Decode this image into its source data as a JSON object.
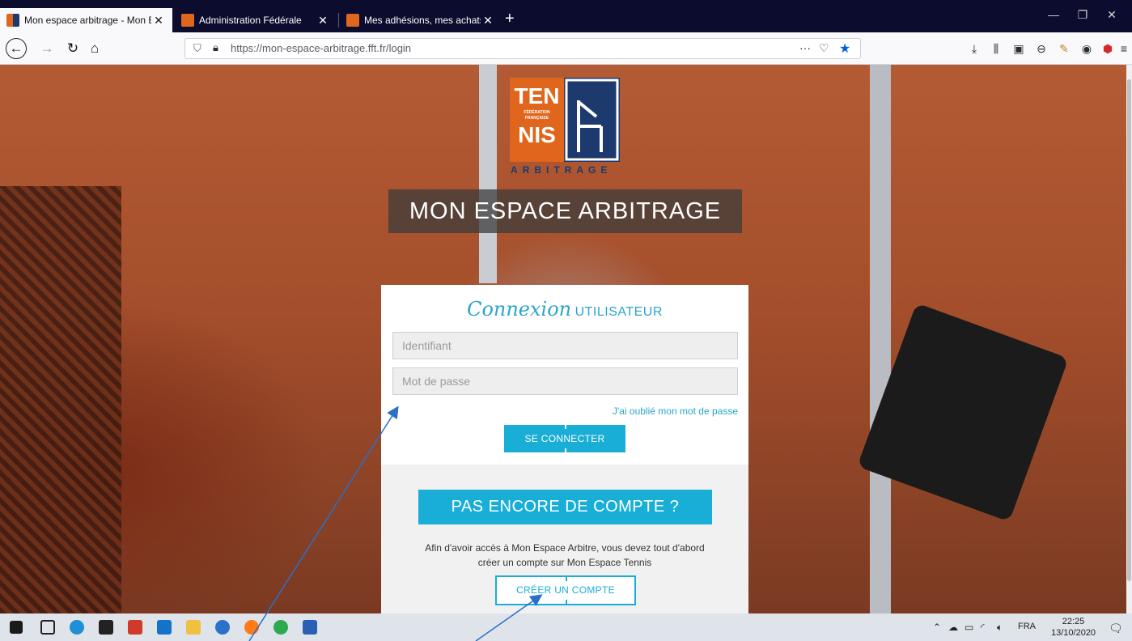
{
  "browser": {
    "tabs": [
      {
        "title": "Mon espace arbitrage - Mon E"
      },
      {
        "title": "Administration Fédérale"
      },
      {
        "title": "Mes adhésions, mes achats | Te"
      }
    ],
    "url": "https://mon-espace-arbitrage.fft.fr/login"
  },
  "logo": {
    "line1": "TEN",
    "line2": "NIS",
    "small1": "FÉDÉRATION",
    "small2": "FRANÇAISE",
    "sub": "ARBITRAGE"
  },
  "page": {
    "heading": "MON ESPACE ARBITRAGE",
    "login": {
      "title_script": "Connexion",
      "title_upper": "UTILISATEUR",
      "username_placeholder": "Identifiant",
      "password_placeholder": "Mot de passe",
      "forgot": "J'ai oublié mon mot de passe",
      "submit": "SE CONNECTER"
    },
    "signup": {
      "banner": "PAS ENCORE DE COMPTE ?",
      "info_line1": "Afin d'avoir accès à Mon Espace Arbitre, vous devez tout d'abord",
      "info_line2": "créer un compte sur Mon Espace Tennis",
      "button": "CRÉER UN COMPTE"
    }
  },
  "taskbar": {
    "lang": "FRA",
    "time": "22:25",
    "date": "13/10/2020"
  },
  "colors": {
    "accent": "#19aed6",
    "tabstrip": "#0c0c2e",
    "logo_orange": "#e0651d",
    "logo_blue": "#1c3a6e"
  }
}
